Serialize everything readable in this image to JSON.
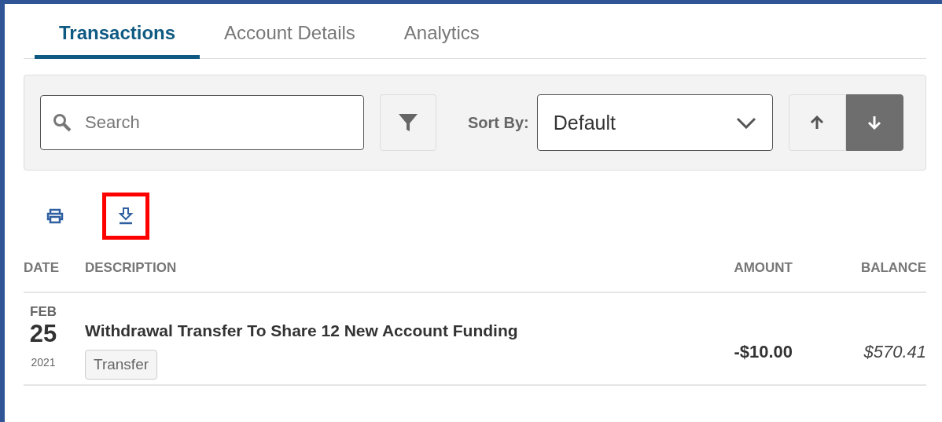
{
  "tabs": [
    {
      "label": "Transactions",
      "selected": true
    },
    {
      "label": "Account Details",
      "selected": false
    },
    {
      "label": "Analytics",
      "selected": false
    }
  ],
  "toolbar": {
    "search": {
      "placeholder": "Search"
    },
    "sort_label": "Sort By:",
    "sort_value": "Default",
    "sort_directions": [
      {
        "kind": "ascending",
        "selected": false
      },
      {
        "kind": "descending",
        "selected": true
      }
    ]
  },
  "actions": [
    {
      "kind": "print",
      "highlighted": false
    },
    {
      "kind": "download",
      "highlighted": true
    }
  ],
  "table": {
    "columns": [
      "DATE",
      "DESCRIPTION",
      "AMOUNT",
      "BALANCE"
    ],
    "rows": [
      {
        "month": "FEB",
        "day": "25",
        "year": "2021",
        "description": "Withdrawal Transfer To Share 12 New Account Funding",
        "tag": "Transfer",
        "amount": "-$10.00",
        "balance": "$570.41"
      }
    ]
  }
}
